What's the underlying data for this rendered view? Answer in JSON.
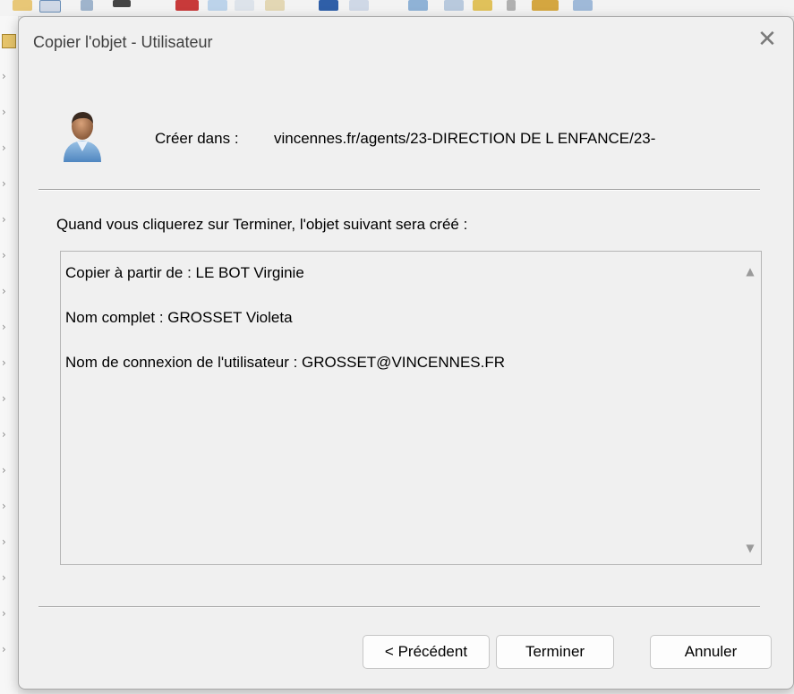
{
  "dialog": {
    "title": "Copier l'objet - Utilisateur",
    "close_icon": "close-icon",
    "user_icon": "user-icon",
    "create_in_label": "Créer dans :",
    "create_in_path": "vincennes.fr/agents/23-DIRECTION DE L ENFANCE/23-",
    "instruction": "Quand vous cliquerez sur Terminer, l'objet suivant sera créé :",
    "summary": [
      "Copier à partir de : LE BOT Virginie",
      "Nom complet : GROSSET Violeta",
      "Nom de connexion de l'utilisateur : GROSSET@VINCENNES.FR"
    ],
    "buttons": {
      "previous": "< Précédent",
      "finish": "Terminer",
      "cancel": "Annuler"
    }
  },
  "colors": {
    "dialog_bg": "#f0f0f0",
    "border": "#a8a8a8",
    "button_bg": "#fdfdfd"
  }
}
